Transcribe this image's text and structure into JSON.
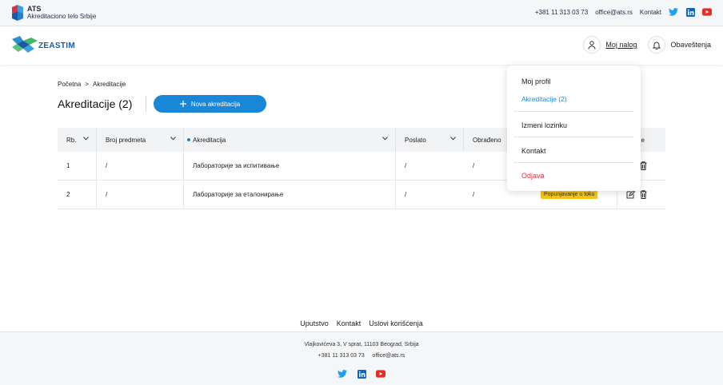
{
  "topbar": {
    "org_short": "ATS",
    "org_full": "Akreditaciono telo Srbije",
    "phone": "+381 11 313 03 73",
    "email": "office@ats.rs",
    "contact_label": "Kontakt"
  },
  "header": {
    "logo_text": "ZEASTIM",
    "account_label": "Moj nalog",
    "notifications_label": "Obaveštenja"
  },
  "breadcrumb": {
    "home": "Početna",
    "separator": ">",
    "current": "Akreditacije"
  },
  "page": {
    "title": "Akreditacije (2)",
    "new_button_label": "Nova akreditacija"
  },
  "table": {
    "headers": {
      "rb": "Rb.",
      "broj": "Broj predmeta",
      "akreditacija": "Akreditacija",
      "poslato": "Poslato",
      "obradjeno": "Obrađeno",
      "akcije": "e"
    },
    "rows": [
      {
        "rb": "1",
        "broj": "/",
        "akreditacija": "Лабораторије за испитивање",
        "poslato": "/",
        "obradjeno": "/",
        "status": ""
      },
      {
        "rb": "2",
        "broj": "/",
        "akreditacija": "Лабораторије за еталонирање",
        "poslato": "/",
        "obradjeno": "/",
        "status": "Popunjavanje u toku"
      }
    ]
  },
  "dropdown": {
    "items": [
      "Moj profil",
      "Akreditacije (2)",
      "Izmeni lozinku",
      "Kontakt",
      "Odjava"
    ]
  },
  "footer": {
    "links": [
      "Uputstvo",
      "Kontakt",
      "Uslovi korišćenja"
    ],
    "address": "Vlajkovićeva 3, V sprat, 11103 Beograd, Srbija",
    "phone": "+381 11 313 03 73",
    "email": "office@ats.rs"
  },
  "icons": {
    "twitter": "twitter-icon",
    "linkedin": "linkedin-icon",
    "youtube": "youtube-icon",
    "user": "user-icon",
    "bell": "bell-icon",
    "plus": "plus-icon",
    "chevron": "chevron-down-icon",
    "edit": "edit-icon",
    "trash": "trash-icon"
  },
  "colors": {
    "accent": "#1a86d6",
    "danger": "#e0303a",
    "badge": "#f5c518",
    "twitter": "#1da1f2",
    "linkedin": "#0a66c2",
    "youtube": "#e52d27"
  }
}
